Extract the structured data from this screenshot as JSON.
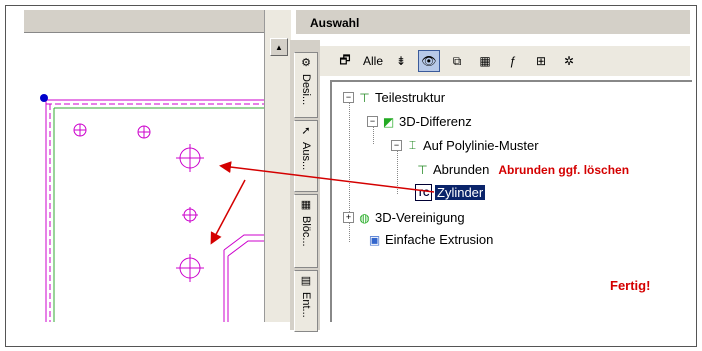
{
  "panel": {
    "title": "Auswahl"
  },
  "toolbar": {
    "alle_label": "Alle"
  },
  "tabs": [
    {
      "label": "Desi..."
    },
    {
      "label": "Aus..."
    },
    {
      "label": "Blöc..."
    },
    {
      "label": "Ent..."
    }
  ],
  "tree": {
    "root": "Teilestruktur",
    "n1": "3D-Differenz",
    "n2": "Auf Polylinie-Muster",
    "n3": "Abrunden",
    "n4": "Zylinder",
    "n5": "3D-Vereinigung",
    "n6": "Einfache Extrusion"
  },
  "annotations": {
    "abrunden_note": "Abrunden ggf. löschen",
    "fertig": "Fertig!"
  },
  "colors": {
    "annotation": "#d40000",
    "cad_lines": "#cc00cc",
    "selection": "#0a246a"
  }
}
